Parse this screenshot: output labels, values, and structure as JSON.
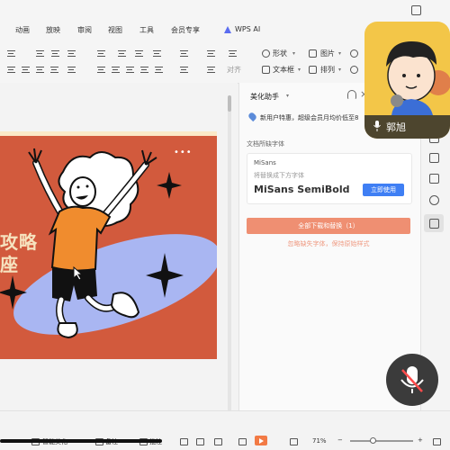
{
  "menu": {
    "items": [
      "动画",
      "放映",
      "审阅",
      "视图",
      "工具",
      "会员专享"
    ],
    "wps_ai": "WPS AI"
  },
  "toolbar": {
    "shape": "形状",
    "picture": "图片",
    "textbox": "文本框",
    "arrange": "排列",
    "align": "对齐"
  },
  "slide": {
    "title_line1": "攻略",
    "title_line2": "座",
    "more": "•••"
  },
  "panel": {
    "title": "美化助手",
    "promo": "新用户特惠，超级会员月均价低至8",
    "section_label": "文档所缺字体",
    "font_card": {
      "name": "MiSans",
      "subtitle": "将替换成下方字体",
      "sample": "MiSans SemiBold",
      "use_button": "立即使用"
    },
    "download_button": "全部下载和替换（1）",
    "skip_text": "忽略缺失字体，保持原始样式"
  },
  "statusbar": {
    "smart_beautify": "智能美化",
    "notes": "备注",
    "comments": "批注",
    "zoom": "71%"
  },
  "video": {
    "name": "郭旭"
  },
  "colors": {
    "slide_bg": "#d25a3d",
    "slide_text": "#f6e3bf",
    "primary_blue": "#3f7ff4",
    "download_orange": "#ef8f72",
    "video_bg": "#f3c648"
  }
}
